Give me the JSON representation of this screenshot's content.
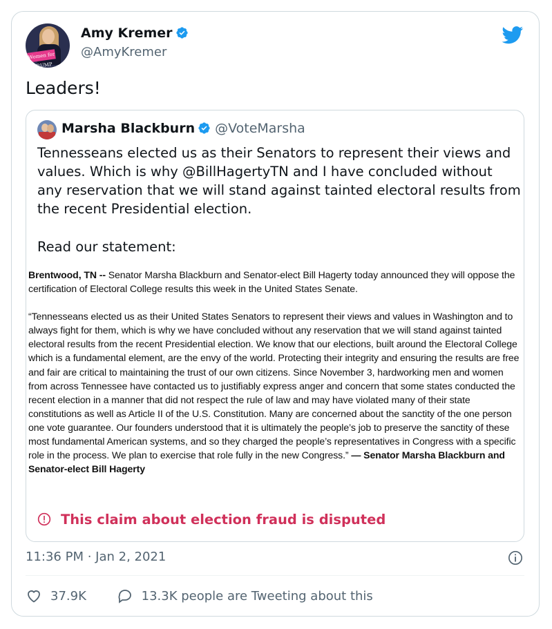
{
  "tweet": {
    "author_name": "Amy Kremer",
    "author_handle": "@AmyKremer",
    "avatar_sign": "Women for TRUMP",
    "text": "Leaders!",
    "timestamp": "11:36 PM · Jan 2, 2021",
    "likes": "37.9K",
    "retweets_text": "13.3K people are Tweeting about this"
  },
  "quoted": {
    "author_name": "Marsha Blackburn",
    "author_handle": "@VoteMarsha",
    "text_1": "Tennesseans elected us as their Senators to represent their views and values. Which is why @BillHagertyTN and I have concluded without any reservation that we will stand against tainted electoral results from the recent Presidential election.",
    "text_2": "Read our statement:",
    "statement": {
      "dateline": "Brentwood, TN --",
      "p1_rest": " Senator Marsha Blackburn and Senator-elect Bill Hagerty today announced they will oppose the certification of Electoral College results this week in the United States Senate.",
      "p2": "“Tennesseans elected us as their United States Senators to represent their views and values in Washington and to always fight for them, which is why we have concluded without any reservation that we will stand against tainted electoral results from the recent Presidential election. We know that our elections, built around the Electoral College which is a fundamental element, are the envy of the world. Protecting their integrity and ensuring the results are free and fair are critical to maintaining the trust of our own citizens. Since November 3, hardworking men and women from across Tennessee have contacted us to justifiably express anger and concern that some states conducted the recent election in a manner that did not respect the rule of law and may have violated many of their state constitutions as well as Article II of the U.S. Constitution. Many are concerned about the sanctity of the one person one vote guarantee. Our founders understood that it is ultimately the people’s job to preserve the sanctity of these most fundamental American systems, and so they charged the people’s representatives in Congress with a specific role in the process. We plan to exercise that role fully in the new Congress.”",
      "signature": " — Senator Marsha Blackburn and Senator-elect Bill Hagerty"
    },
    "warning": "This claim about election fraud is disputed"
  },
  "colors": {
    "brand_blue": "#1d9bf0",
    "warning": "#d0305a",
    "secondary_text": "#536471"
  },
  "icons": [
    "verified-badge-icon",
    "twitter-bird-icon",
    "alert-circle-icon",
    "info-icon",
    "heart-icon",
    "comment-icon"
  ]
}
